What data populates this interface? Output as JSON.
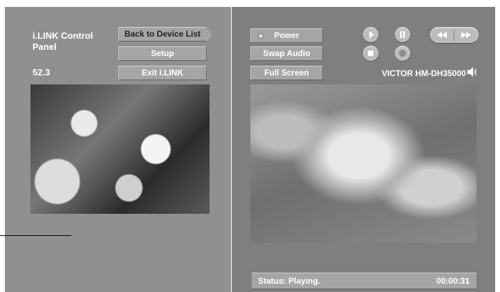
{
  "app": {
    "title": "i.LINK Control Panel",
    "channel": "52.3"
  },
  "left_buttons": {
    "back": "Back to Device List",
    "setup": "Setup",
    "exit": "Exit i.LINK"
  },
  "right_buttons": {
    "power": "Power",
    "swap_audio": "Swap Audio",
    "full_screen": "Full Screen"
  },
  "transport": {
    "icons": [
      "play-icon",
      "pause-icon",
      "stop-icon",
      "record-icon",
      "rewind-icon",
      "fast-forward-icon"
    ]
  },
  "device": {
    "name": "VICTOR HM-DH35000",
    "icon": "speaker-icon"
  },
  "status": {
    "text": "Status: Playing.",
    "time": "00:00:31"
  },
  "colors": {
    "left_pane": "#909090",
    "right_pane": "#7f7f7f",
    "button": "#a5a5a5"
  }
}
